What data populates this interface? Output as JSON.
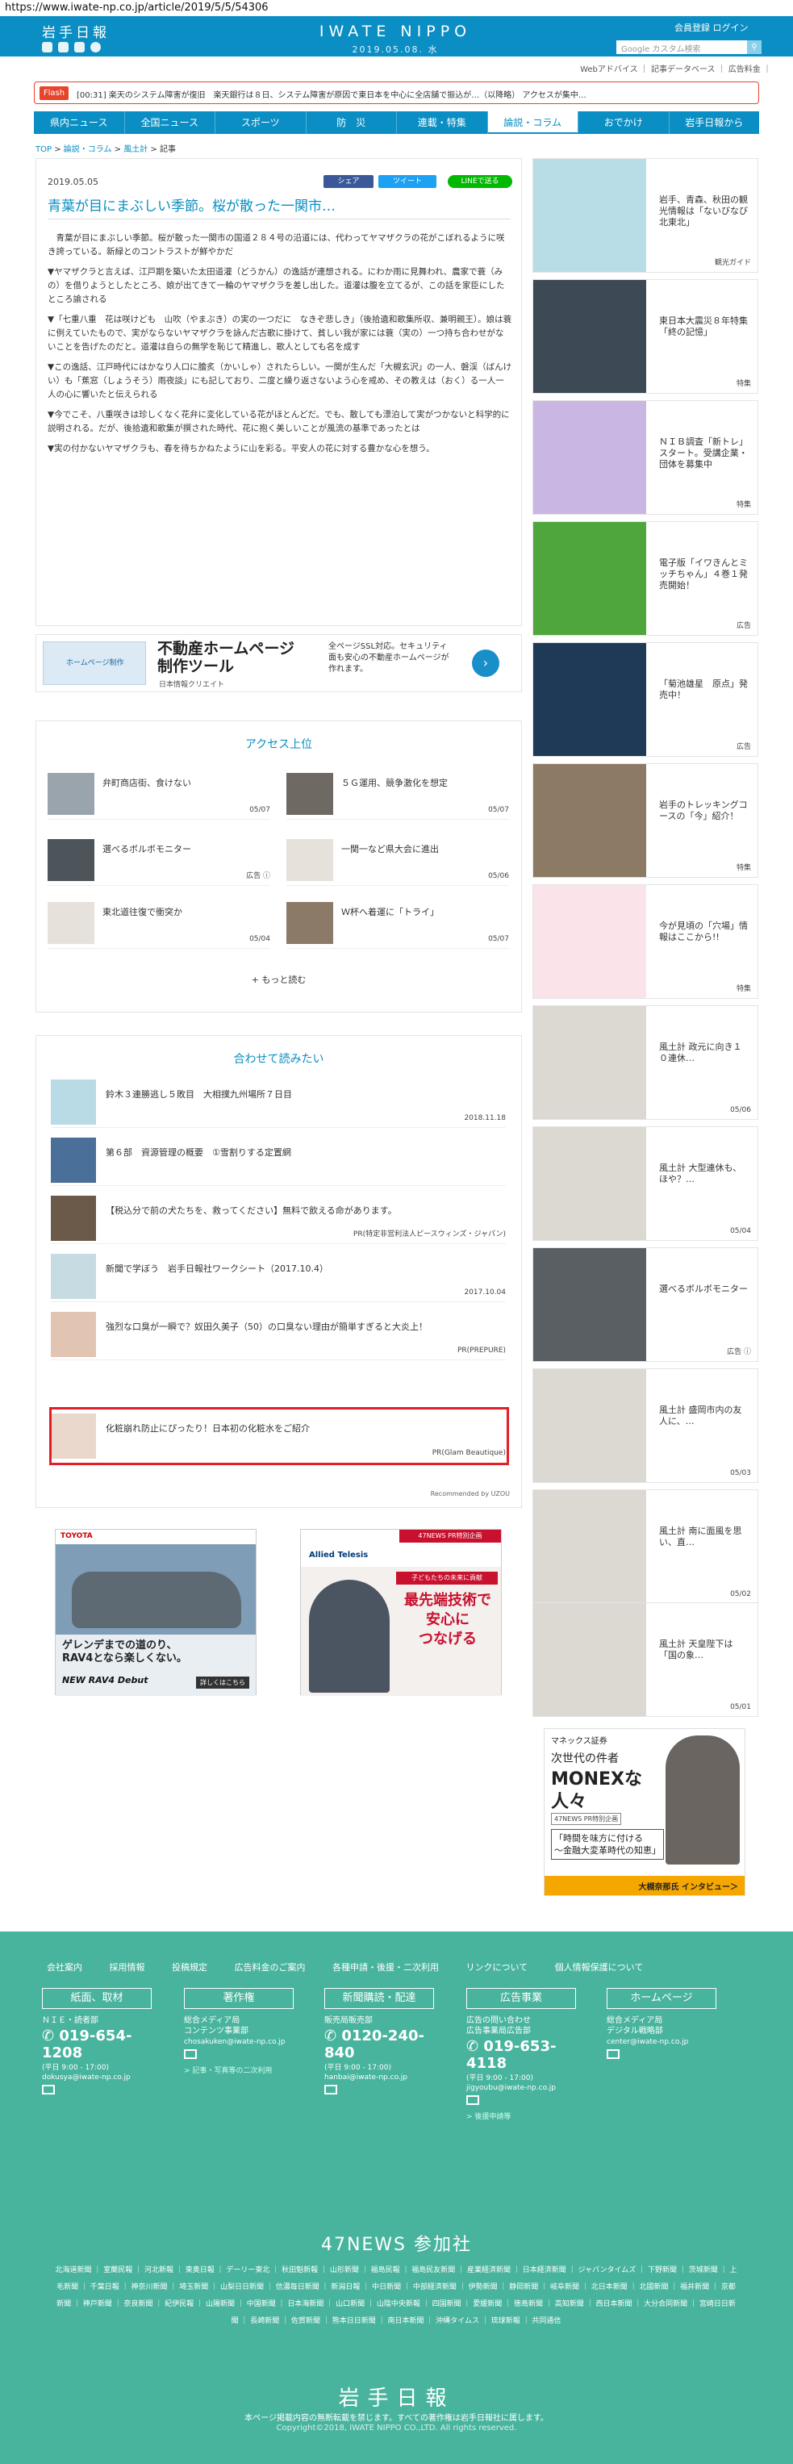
{
  "url": "https://www.iwate-np.co.jp/article/2019/5/5/54306",
  "header": {
    "logo_top": "岩手日報",
    "brand": "IWATE NIPPO",
    "date": "2019.05.08. 水",
    "links": "会員登録  ログイン",
    "search_placeholder": "Google カスタム検索",
    "search_button": "検索"
  },
  "util": "Webアドバイス ｜ 記事データベース ｜ 広告料金 ｜",
  "flash": {
    "label": "Flash",
    "text": "[00:31] 楽天のシステム障害が復旧　楽天銀行は８日、システム障害が原因で東日本を中心に全店舗で振込が…（以降略） アクセスが集中…"
  },
  "nav": [
    "県内ニュース",
    "全国ニュース",
    "スポーツ",
    "防　災",
    "連載・特集",
    "論説・コラム",
    "おでかけ",
    "岩手日報から"
  ],
  "nav_active": 5,
  "breadcrumb": {
    "top": "TOP",
    "sep": " > ",
    "c1": "論説・コラム",
    "c2": "風土計",
    "current": "記事"
  },
  "article": {
    "date": "2019.05.05",
    "title": "青葉が目にまぶしい季節。桜が散った一関市…",
    "share": {
      "facebook": "シェア",
      "twitter": "ツイート",
      "line": "LINEで送る"
    },
    "paragraphs": [
      "青葉が目にまぶしい季節。桜が散った一関市の国道２８４号の沿道には、代わってヤマザクラの花がこぼれるように咲き誇っている。新緑とのコントラストが鮮やかだ",
      "▼ヤマザクラと言えば、江戸期を築いた太田道灌（どうかん）の逸話が連想される。にわか雨に見舞われ、農家で蓑（みの）を借りようとしたところ、娘が出てきて一輪のヤマザクラを差し出した。道灌は腹を立てるが、この話を家臣にしたところ諭される",
      "▼「七重八重　花は咲けども　山吹（やまぶき）の実の一つだに　なきぞ悲しき」（後拾遺和歌集所収、兼明親王）。娘は蓑に例えていたもので、実がならないヤマザクラを詠んだ古歌に掛けて、貧しい我が家には蓑（実の）一つ持ち合わせがないことを告げたのだと。道灌は自らの無学を恥じて精進し、歌人としても名を成す",
      "▼この逸話、江戸時代にはかなり人口に膾炙（かいしゃ）されたらしい。一関が生んだ「大槻玄沢」の一人、磐渓（ばんけい）も「蕉窓（しょうそう）雨夜談」にも記しており、二度と繰り返さないよう心を戒め、その教えは（おく）る一人一人の心に響いたと伝えられる",
      "▼今でこそ、八重咲きは珍しくなく花弁に変化している花がほとんどだ。でも、散しても漂泊して実がつかないと科学的に説明される。だが、後拾遺和歌集が撰された時代、花に抱く美しいことが風流の基準であったとは",
      "▼実の付かないヤマザクラも、春を待ちかねたように山を彩る。平安人の花に対する豊かな心を想う。"
    ]
  },
  "ad1": {
    "badge": "ホームページ制作",
    "title_line1": "不動産ホームページ",
    "title_line2": "制作ツール",
    "sub": "日本情報クリエイト",
    "desc": "全ページSSL対応。セキュリティ面も安心の不動産ホームページが作れます。",
    "go": "›"
  },
  "ranking": {
    "title": "アクセス上位",
    "items": [
      {
        "title": "弁町商店街、食けない",
        "date": "05/07"
      },
      {
        "title": "５Ｇ運用、競争激化を想定",
        "date": "05/07"
      },
      {
        "title": "選べるボルボモニター",
        "date": "広告 ⓘ"
      },
      {
        "title": "一関一など県大会に進出",
        "date": "05/06"
      },
      {
        "title": "東北道往復で衝突か",
        "date": "05/04"
      },
      {
        "title": "Ｗ杯へ着運に「トライ」",
        "date": "05/07"
      }
    ],
    "more": "もっと読む"
  },
  "reco": {
    "title": "合わせて読みたい",
    "items": [
      {
        "title": "鈴木３連勝逃し５敗目　大相撲九州場所７日目",
        "meta": "2018.11.18"
      },
      {
        "title": "第６部　資源管理の概要　①雪割りする定置網",
        "meta": ""
      },
      {
        "title": "【税込分で前の犬たちを、救ってください】無料で飲える命があります。",
        "meta": "PR(特定非営利法人ピースウィンズ・ジャパン)"
      },
      {
        "title": "新聞で学ぼう　岩手日報社ワークシート（2017.10.4）",
        "meta": "2017.10.04"
      },
      {
        "title": "強烈な口臭が一瞬で？奴田久美子（50）の口臭ない理由が簡単すぎると大炎上！",
        "meta": "PR(PREPURE)"
      },
      {
        "title": "化粧崩れ防止にぴったり！日本初の化粧水をご紹介",
        "meta": "PR(Glam Beautique)"
      }
    ],
    "powered": "Recommended by UZOU"
  },
  "banner1": {
    "brand": "TOYOTA",
    "copy1": "ゲレンデまでの道のり、",
    "copy2": "RAV4となら楽しくない。",
    "model": "NEW RAV4 Debut",
    "cta": "詳しくはこちら"
  },
  "banner2": {
    "brand": "Allied Telesis",
    "badge": "47NEWS PR特別企画",
    "tag": "子どもたちの未来に貢献",
    "copy1": "最先端技術で",
    "copy2": "安心に",
    "copy3": "つなげる"
  },
  "sidebar": [
    {
      "text": "岩手、青森、秋田の観光情報は「ないびなび北東北」",
      "meta": "観光ガイド"
    },
    {
      "text": "東日本大震災８年特集「終の記憶」",
      "meta": "特集"
    },
    {
      "text": "ＮＩＢ調査「新トレ」スタート。受講企業・団体を募集中",
      "meta": "特集"
    },
    {
      "text": "電子版「イワきんとミッチちゃん」４巻１発売開始！",
      "meta": "広告"
    },
    {
      "text": "「菊池雄星　原点」発売中！",
      "meta": "広告"
    },
    {
      "text": "岩手のトレッキングコースの「今」紹介！",
      "meta": "特集"
    },
    {
      "text": "今が見頃の「穴場」情報はここから!!",
      "meta": "特集"
    },
    {
      "text": "風土計 政元に向き１０連休…",
      "meta": "05/06"
    },
    {
      "text": "風土計 大型連休も、ほや？…",
      "meta": "05/04"
    },
    {
      "text": "選べるボルボモニター",
      "meta": "広告 ⓘ"
    },
    {
      "text": "風土計 盛岡市内の友人に、…",
      "meta": "05/03"
    },
    {
      "text": "風土計 南に面風を思い、直…",
      "meta": "05/02"
    },
    {
      "text": "風土計 天皇陛下は「国の象…",
      "meta": "05/01"
    }
  ],
  "side_ad": {
    "brand": "マネックス証券",
    "copy1": "次世代の件者",
    "copy2": "MONEXな",
    "copy3": "人々",
    "tag": "47NEWS PR特別企画",
    "quote1": "「時間を味方に付ける",
    "quote2": "～金融大変革時代の知恵」",
    "bottom": "大槻奈那氏 インタビュー＞"
  },
  "footer": {
    "links": [
      "会社案内",
      "採用情報",
      "投稿規定",
      "広告料金のご案内",
      "各種申請・後援・二次利用",
      "リンクについて",
      "個人情報保護について"
    ],
    "cols": [
      {
        "head": "紙面、取材",
        "sub": "ＮＩＥ・読者部",
        "tel": "019-654-1208",
        "hours": "(平日 9:00 - 17:00)",
        "mail": "dokusya@iwate-np.co.jp",
        "link": ""
      },
      {
        "head": "著作権",
        "sub": "総合メディア局\nコンテンツ事業部",
        "tel": "",
        "hours": "",
        "mail": "chosakuken@iwate-np.co.jp",
        "link": "> 記事・写真等の二次利用"
      },
      {
        "head": "新聞購読・配達",
        "sub": "販売局販売部",
        "tel": "0120-240-840",
        "hours": "(平日 9:00 - 17:00)",
        "mail": "hanbai@iwate-np.co.jp",
        "link": ""
      },
      {
        "head": "広告事業",
        "sub": "広告の問い合わせ\n広告事業局広告部",
        "tel": "019-653-4118",
        "hours": "(平日 9:00 - 17:00)",
        "mail": "jigyoubu@iwate-np.co.jp",
        "link": "> 後援申請等"
      },
      {
        "head": "ホームページ",
        "sub": "総合メディア局\nデジタル戦略部",
        "tel": "",
        "hours": "",
        "mail": "center@iwate-np.co.jp",
        "link": ""
      }
    ],
    "news47_title": "47NEWS 参加社",
    "news47_list": "北海道新聞 ｜ 室蘭民報 ｜ 河北新報 ｜ 東奥日報 ｜ デーリー東北 ｜ 秋田魁新報 ｜ 山形新聞 ｜ 福島民報 ｜ 福島民友新聞 ｜ 産業経済新聞 ｜ 日本経済新聞 ｜ ジャパンタイムズ ｜ 下野新聞 ｜ 茨城新聞 ｜ 上毛新聞 ｜ 千葉日報 ｜ 神奈川新聞 ｜ 埼玉新聞 ｜ 山梨日日新聞 ｜ 信濃毎日新聞 ｜ 新潟日報 ｜ 中日新聞 ｜ 中部経済新聞 ｜ 伊勢新聞 ｜ 静岡新聞 ｜ 岐阜新聞 ｜ 北日本新聞 ｜ 北國新聞 ｜ 福井新聞 ｜ 京都新聞 ｜ 神戸新聞 ｜ 奈良新聞 ｜ 紀伊民報 ｜ 山陽新聞 ｜ 中国新聞 ｜ 日本海新聞 ｜ 山口新聞 ｜ 山陰中央新報 ｜ 四国新聞 ｜ 愛媛新聞 ｜ 徳島新聞 ｜ 高知新聞 ｜ 西日本新聞 ｜ 大分合同新聞 ｜ 宮崎日日新聞 ｜ 長崎新聞 ｜ 佐賀新聞 ｜ 熊本日日新聞 ｜ 南日本新聞 ｜ 沖縄タイムス ｜ 琉球新報 ｜ 共同通信",
    "logo": "岩手日報",
    "note": "本ページ掲載内容の無断転載を禁じます。すべての著作権は岩手日報社に属します。",
    "copyright": "Copyright©2018, IWATE NIPPO CO.,LTD. All rights reserved."
  }
}
